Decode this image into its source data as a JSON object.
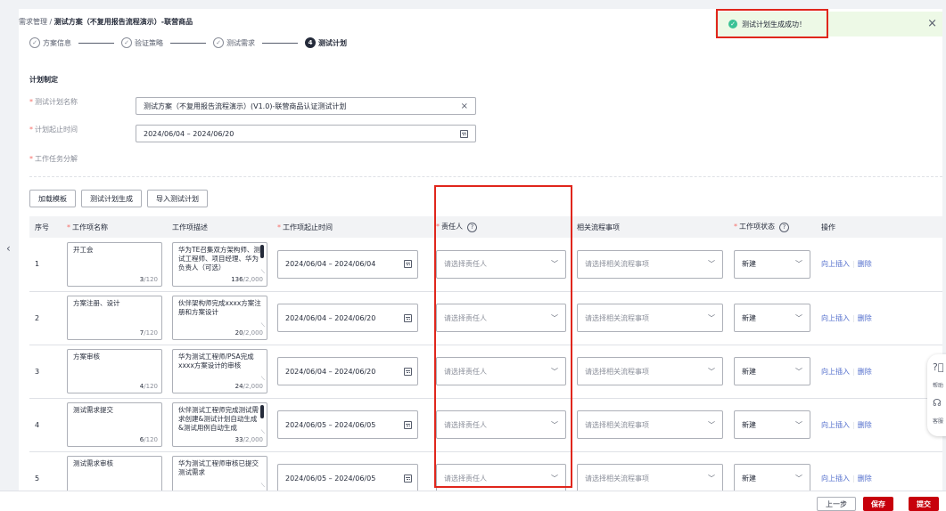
{
  "breadcrumb": {
    "root": "需求管理",
    "separator": "/",
    "current": "测试方案（不复用报告流程演示）-联营商品"
  },
  "steps": [
    {
      "label": "方案信息",
      "state": "done"
    },
    {
      "label": "验证策略",
      "state": "done"
    },
    {
      "label": "测试需求",
      "state": "done"
    },
    {
      "label": "测试计划",
      "state": "current",
      "num": "4"
    }
  ],
  "plan": {
    "section_title": "计划制定",
    "name_label": "测试计划名称",
    "name_value": "测试方案（不复用报告流程演示）(V1.0)-联营商品认证测试计划",
    "date_label": "计划起止时间",
    "date_value": "2024/06/04 – 2024/06/20",
    "tasks_label": "工作任务分解"
  },
  "toolbar": {
    "template": "加载模板",
    "generate": "测试计划生成",
    "import": "导入测试计划"
  },
  "table": {
    "headers": {
      "seq": "序号",
      "name": "工作项名称",
      "desc": "工作项描述",
      "time": "工作项起止时间",
      "owner": "责任人",
      "flow": "相关流程事项",
      "status": "工作项状态",
      "ops": "操作"
    },
    "owner_placeholder": "请选择责任人",
    "flow_placeholder": "请选择相关流程事项",
    "op_insert": "向上插入",
    "op_delete": "删除",
    "rows": [
      {
        "seq": "1",
        "name": "开工会",
        "name_count": "3",
        "name_max": "/120",
        "desc": "华为TE召集双方架构师、测试工程师、项目经理、华为负责人（可选）",
        "desc_count": "136",
        "desc_max": "/2,000",
        "time": "2024/06/04 – 2024/06/04",
        "status": "新建"
      },
      {
        "seq": "2",
        "name": "方案注册、设计",
        "name_count": "7",
        "name_max": "/120",
        "desc": "伙伴架构师完成xxxx方案注册和方案设计",
        "desc_count": "20",
        "desc_max": "/2,000",
        "time": "2024/06/04 – 2024/06/20",
        "status": "新建"
      },
      {
        "seq": "3",
        "name": "方案审核",
        "name_count": "4",
        "name_max": "/120",
        "desc": "华为测试工程师/PSA完成xxxx方案设计的审核",
        "desc_count": "24",
        "desc_max": "/2,000",
        "time": "2024/06/04 – 2024/06/20",
        "status": "新建"
      },
      {
        "seq": "4",
        "name": "测试需求提交",
        "name_count": "6",
        "name_max": "/120",
        "desc": "伙伴测试工程师完成测试需求创建&测试计划自动生成&测试用例自动生成",
        "desc_count": "33",
        "desc_max": "/2,000",
        "time": "2024/06/05 – 2024/06/05",
        "status": "新建"
      },
      {
        "seq": "5",
        "name": "测试需求审核",
        "name_count": "",
        "name_max": "",
        "desc": "华为测试工程师审核已提交测试需求",
        "desc_count": "",
        "desc_max": "",
        "time": "2024/06/05 – 2024/06/05",
        "status": "新建"
      }
    ]
  },
  "toast": {
    "message": "测试计划生成成功！"
  },
  "sidebar": {
    "help": "帮助",
    "service": "客服"
  },
  "footer": {
    "prev": "上一步",
    "save": "保存",
    "submit": "提交"
  },
  "colors": {
    "accent": "#c7000b",
    "link": "#526ecc",
    "success": "#3ac295",
    "highlight": "#e0261c"
  }
}
